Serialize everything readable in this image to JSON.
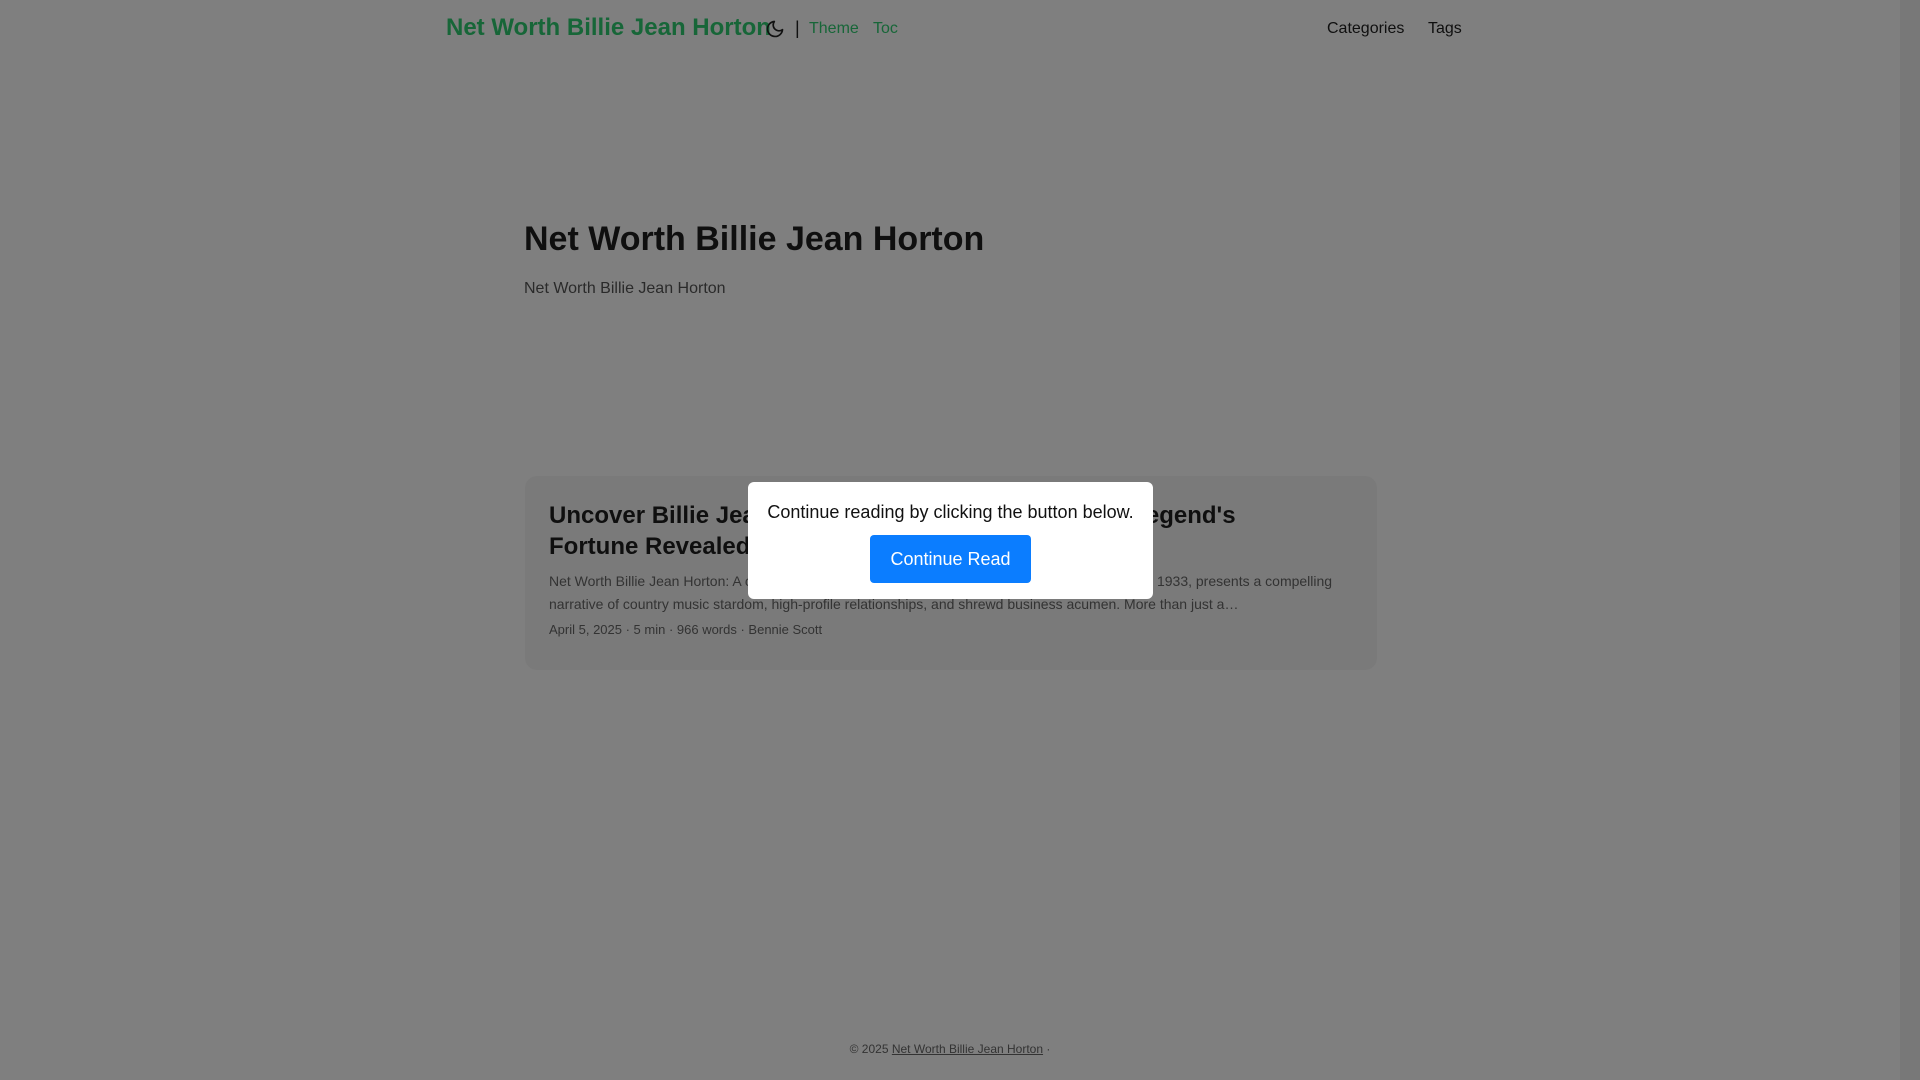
{
  "header": {
    "logo": "Net Worth Billie Jean Horton",
    "theme_icon": "moon-icon",
    "separator": "|",
    "links": [
      "Theme",
      "Toc"
    ],
    "nav": [
      "Categories",
      "Tags"
    ]
  },
  "main": {
    "title": "Net Worth Billie Jean Horton",
    "description": "Net Worth Billie Jean Horton"
  },
  "post": {
    "title": "Uncover Billie Jean Horton's Net Worth: A Country Legend's Fortune Revealed",
    "excerpt": "Net Worth Billie Jean Horton: A captivating figure in country music history, Billie Jean Horton, from 1933, presents a compelling narrative of country music stardom, high-profile relationships, and shrewd business acumen. More than just a…",
    "meta": "April 5, 2025 · 5 min · 966 words · Bennie Scott"
  },
  "footer": {
    "copyright": "© 2025",
    "link": "Net Worth Billie Jean Horton",
    "suffix": "·"
  },
  "modal": {
    "text": "Continue reading by clicking the button below.",
    "button": "Continue Read"
  },
  "colors": {
    "accent": "#2ecc71",
    "button": "#0b7dff",
    "overlay": "rgba(0,0,0,0.5)"
  }
}
